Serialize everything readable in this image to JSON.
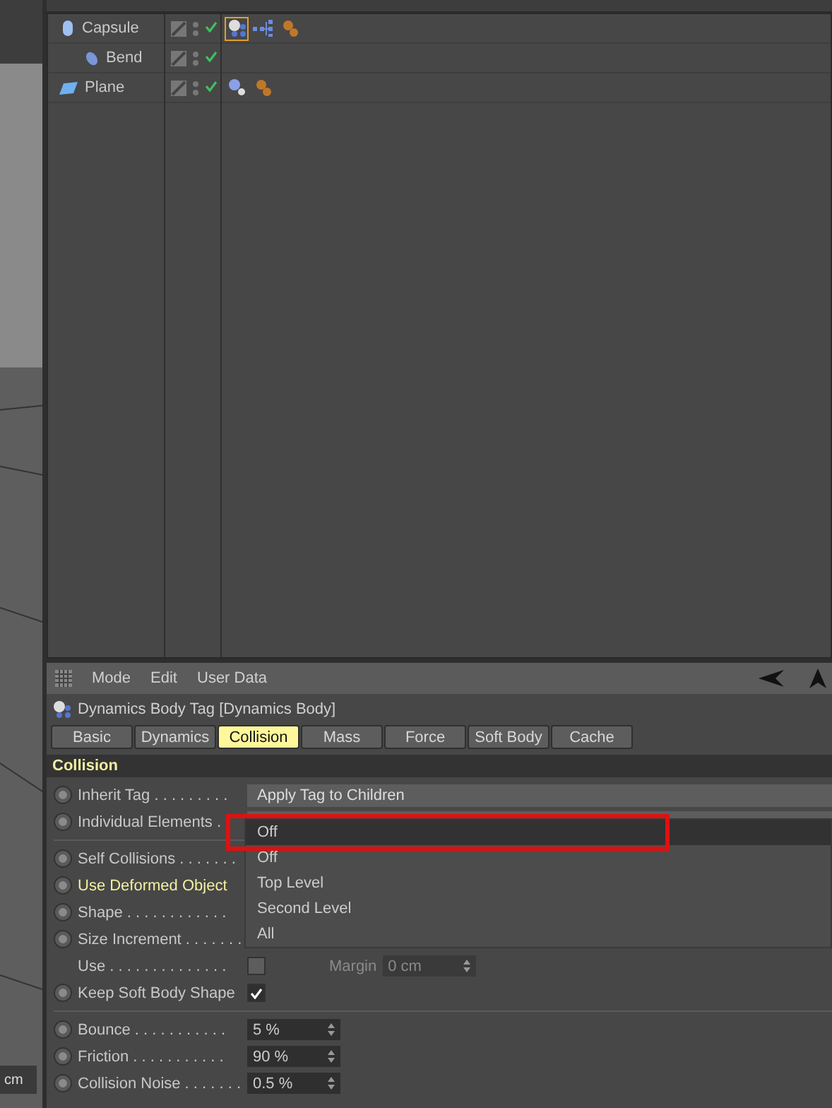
{
  "viewport": {
    "unit": "cm"
  },
  "objects": [
    {
      "name": "Capsule",
      "kind": "capsule",
      "enabled": true,
      "tags": [
        {
          "kind": "dynamics",
          "selected": true
        },
        {
          "kind": "tree",
          "selected": false
        },
        {
          "kind": "spheres",
          "selected": false
        }
      ],
      "children": [
        {
          "name": "Bend",
          "kind": "bend",
          "enabled": true
        }
      ]
    },
    {
      "name": "Plane",
      "kind": "plane",
      "enabled": true,
      "tags": [
        {
          "kind": "collider",
          "selected": false
        },
        {
          "kind": "spheres",
          "selected": false
        }
      ]
    }
  ],
  "attributes": {
    "menu": [
      "Mode",
      "Edit",
      "User Data"
    ],
    "title": "Dynamics Body Tag [Dynamics Body]",
    "tabs": [
      {
        "label": "Basic",
        "selected": false
      },
      {
        "label": "Dynamics",
        "selected": false
      },
      {
        "label": "Collision",
        "selected": true
      },
      {
        "label": "Mass",
        "selected": false
      },
      {
        "label": "Force",
        "selected": false
      },
      {
        "label": "Soft Body",
        "selected": false
      },
      {
        "label": "Cache",
        "selected": false
      }
    ],
    "section": "Collision",
    "params": [
      {
        "kind": "dropdown",
        "label": "Inherit Tag . . . . . . . . .",
        "value": "Apply Tag to Children",
        "highlighted": false,
        "keyframed": false
      },
      {
        "kind": "dropdown",
        "label": "Individual Elements .",
        "value": "Off",
        "highlighted": false,
        "keyframed": false,
        "open": true,
        "options": [
          "Off",
          "Top Level",
          "Second Level",
          "All"
        ]
      },
      {
        "kind": "divider"
      },
      {
        "kind": "covered",
        "label": "Self Collisions . . . . . . .",
        "highlighted": false,
        "keyframed": false
      },
      {
        "kind": "covered",
        "label": "Use Deformed Object",
        "highlighted": true,
        "keyframed": false
      },
      {
        "kind": "covered",
        "label": "Shape . . . . . . . . . . . .",
        "highlighted": false,
        "keyframed": false
      },
      {
        "kind": "covered",
        "label": "Size Increment . . . . . . .",
        "highlighted": false,
        "keyframed": false
      },
      {
        "kind": "use",
        "label": "Use . . . . . . . . . . . . . .",
        "checked": false,
        "margin_label": "Margin",
        "margin_value": "0 cm",
        "highlighted": false
      },
      {
        "kind": "checkbox",
        "label": "Keep Soft Body Shape",
        "checked": true,
        "highlighted": false,
        "keyframed": false
      },
      {
        "kind": "divider"
      },
      {
        "kind": "number",
        "label": "Bounce . . . . . . . . . . .",
        "value": "5 %",
        "highlighted": false,
        "keyframed": false
      },
      {
        "kind": "number",
        "label": "Friction . . . . . . . . . . .",
        "value": "90 %",
        "highlighted": false,
        "keyframed": false
      },
      {
        "kind": "number",
        "label": "Collision Noise . . . . . . .",
        "value": "0.5 %",
        "highlighted": false,
        "keyframed": false
      }
    ]
  }
}
